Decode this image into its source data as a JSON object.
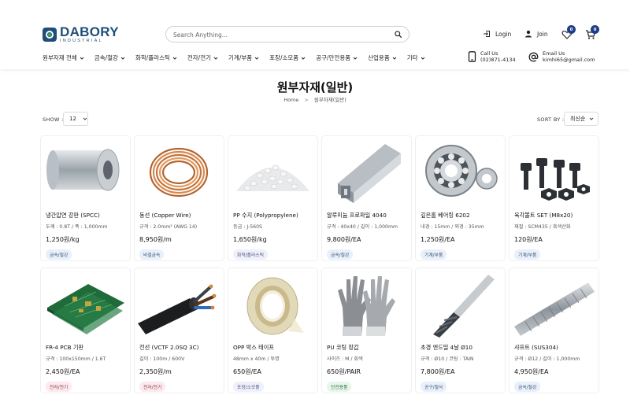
{
  "brand": {
    "name": "DABORY",
    "sub": "INDUSTRIAL"
  },
  "search": {
    "placeholder": "Search Anything..."
  },
  "header": {
    "login": "Login",
    "join": "Join",
    "wishlist_count": "0",
    "cart_count": "0"
  },
  "nav": [
    {
      "label": "원부자재 전체"
    },
    {
      "label": "금속/철강"
    },
    {
      "label": "화학/플라스틱"
    },
    {
      "label": "전자/전기"
    },
    {
      "label": "기계/부품"
    },
    {
      "label": "포장/소모품"
    },
    {
      "label": "공구/안전용품"
    },
    {
      "label": "산업용품"
    },
    {
      "label": "기타"
    }
  ],
  "contact": {
    "call_label": "Call Us",
    "call_value": "(02)871-4134",
    "email_label": "Email Us",
    "email_value": "kimhi65@gmail.com"
  },
  "page": {
    "title": "원부자재(일반)",
    "breadcrumb_home": "Home",
    "breadcrumb_sep": ">",
    "breadcrumb_current": "원부자재(일반)"
  },
  "controls": {
    "show_label": "SHOW :",
    "show_value": "12",
    "sort_label": "SORT BY :",
    "sort_value": "최신순"
  },
  "colors": {
    "brand": "#1f4e79",
    "badge": "#1f3c88",
    "tag_metal": "#e8f0fb",
    "tag_chem": "#eef0fb",
    "tag_mech": "#e8f0fb",
    "tag_elec": "#fde9ee",
    "tag_pack": "#eef0fb",
    "tag_safety": "#e6f6ea"
  },
  "products": [
    {
      "name": "냉간압연 강판 (SPCC)",
      "spec": "두께 : 0.8T / 폭 : 1,000mm",
      "price": "1,250원/kg",
      "tag": "금속/철강",
      "tag_color": "#e8f0fb",
      "image": "steel-coil"
    },
    {
      "name": "동선 (Copper Wire)",
      "spec": "규격 : 2.0mm² (AWG 14)",
      "price": "8,950원/m",
      "tag": "비철금속",
      "tag_color": "#e8f0fb",
      "image": "copper-wire"
    },
    {
      "name": "PP 수지 (Polypropylene)",
      "spec": "등급 : J-560S",
      "price": "1,650원/kg",
      "tag": "화학/플라스틱",
      "tag_color": "#eef0fb",
      "image": "pp-pellets"
    },
    {
      "name": "알루미늄 프로파일 4040",
      "spec": "규격 : 40x40 / 길이 : 1,000mm",
      "price": "9,800원/EA",
      "tag": "금속/철강",
      "tag_color": "#e8f0fb",
      "image": "alu-profile"
    },
    {
      "name": "깊은홈 베어링 6202",
      "spec": "내경 : 15mm / 외경 : 35mm",
      "price": "1,250원/EA",
      "tag": "기계/부품",
      "tag_color": "#e8f0fb",
      "image": "bearing"
    },
    {
      "name": "육각볼트 SET (M8x20)",
      "spec": "재질 : SCM435 / 흑색산화",
      "price": "120원/EA",
      "tag": "기계/부품",
      "tag_color": "#e8f0fb",
      "image": "bolts"
    },
    {
      "name": "FR-4 PCB 기판",
      "spec": "규격 : 100x150mm / 1.6T",
      "price": "2,450원/EA",
      "tag": "전자/전기",
      "tag_color": "#fde9ee",
      "image": "pcb"
    },
    {
      "name": "전선 (VCTF 2.0SQ 3C)",
      "spec": "길이 : 100m / 600V",
      "price": "2,350원/m",
      "tag": "전자/전기",
      "tag_color": "#fde9ee",
      "image": "cable"
    },
    {
      "name": "OPP 박스 테이프",
      "spec": "48mm x 40m / 투명",
      "price": "650원/EA",
      "tag": "포장/소모품",
      "tag_color": "#eef0fb",
      "image": "tape"
    },
    {
      "name": "PU 코팅 장갑",
      "spec": "사이즈 : M / 회색",
      "price": "650원/PAIR",
      "tag": "안전용품",
      "tag_color": "#e6f6ea",
      "image": "gloves"
    },
    {
      "name": "초경 엔드밀 4날 Ø10",
      "spec": "규격 : Ø10 / 코팅 : TAIN",
      "price": "7,800원/EA",
      "tag": "공구/절삭",
      "tag_color": "#e8f0fb",
      "image": "endmill"
    },
    {
      "name": "샤프트 (SUS304)",
      "spec": "규격 : Ø12 / 길이 : 1,000mm",
      "price": "4,950원/EA",
      "tag": "금속/철강",
      "tag_color": "#e8f0fb",
      "image": "shaft"
    }
  ]
}
